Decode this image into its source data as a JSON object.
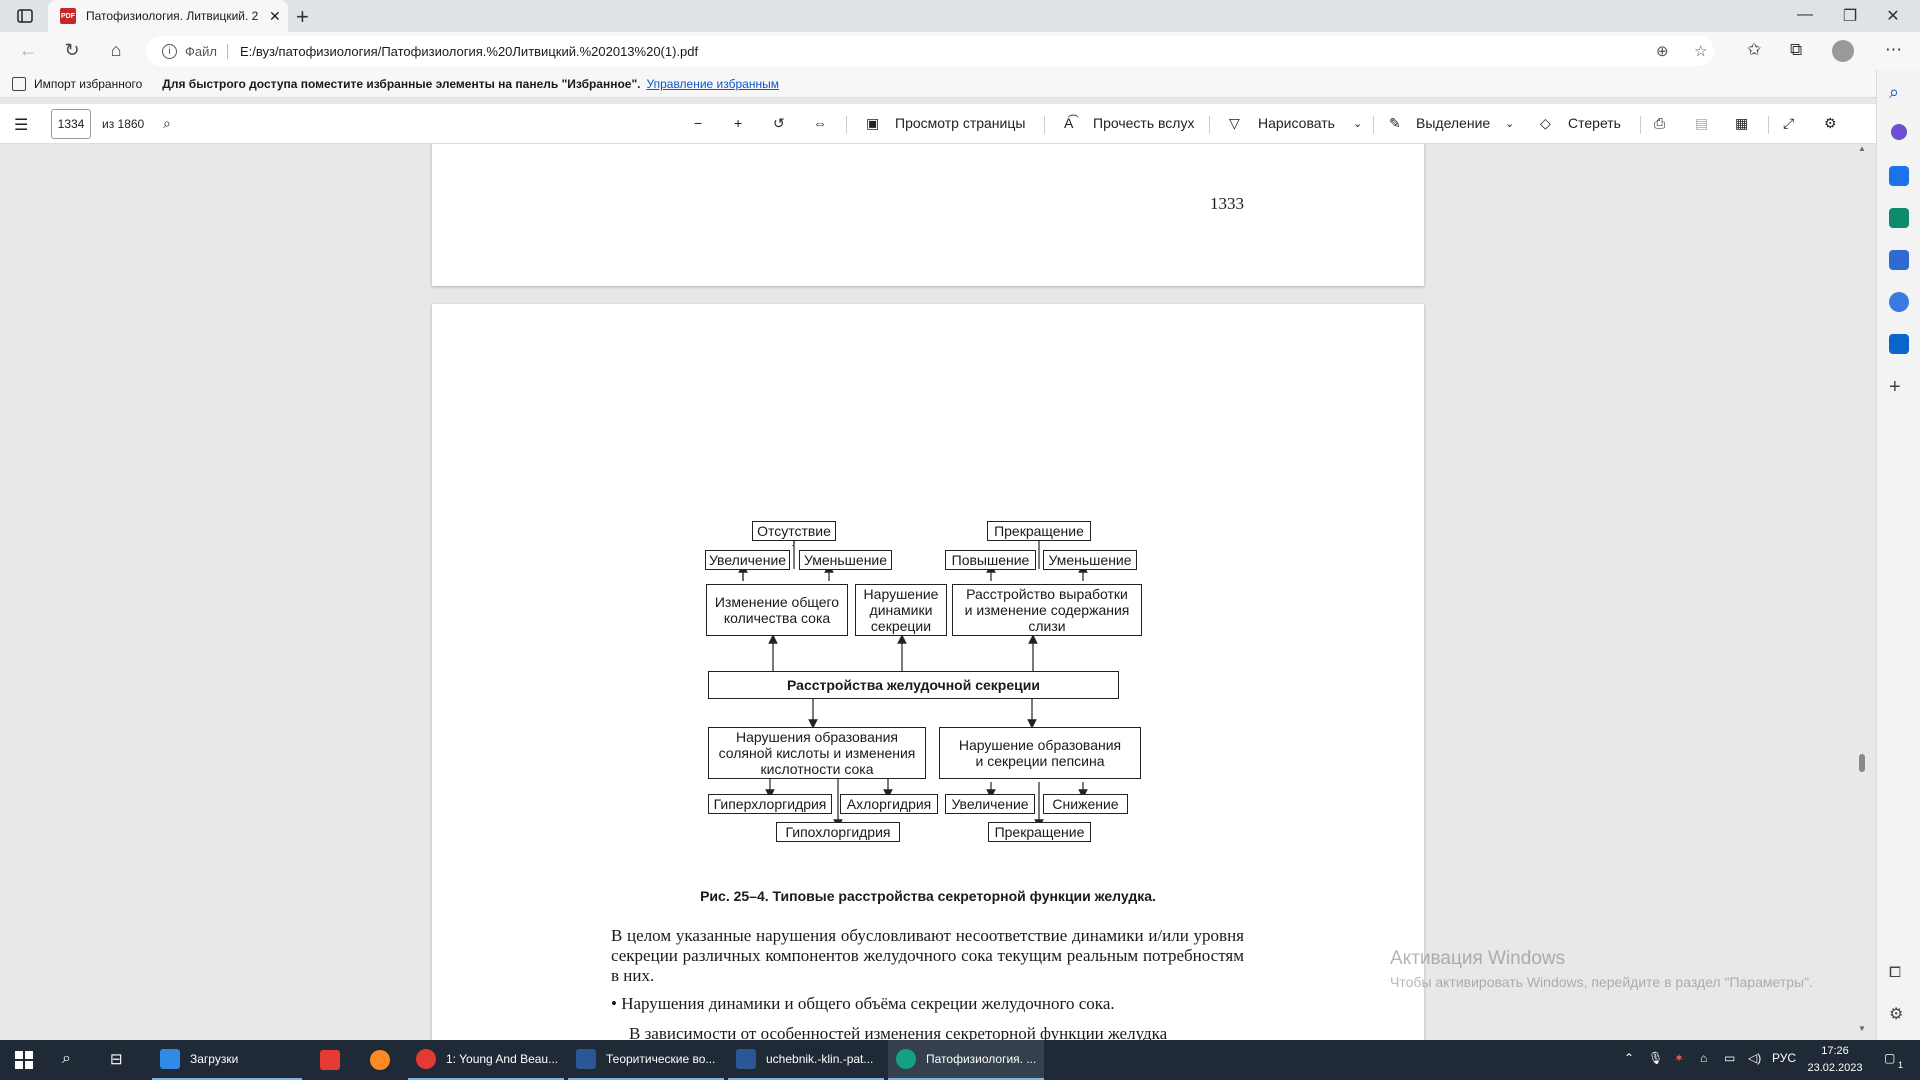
{
  "browser": {
    "tab_title": "Патофизиология. Литвицкий. 2",
    "address": {
      "scheme": "Файл",
      "url": "E:/вуз/патофизиология/Патофизиология.%20Литвицкий.%202013%20(1).pdf"
    },
    "favorites": {
      "import_label": "Импорт избранного",
      "hint": "Для быстрого доступа поместите избранные элементы на панель \"Избранное\".",
      "manage_link": "Управление избранным"
    }
  },
  "pdf_toolbar": {
    "page_current": "1334",
    "page_total": "из 1860",
    "page_view": "Просмотр страницы",
    "read_aloud": "Прочесть вслух",
    "draw": "Нарисовать",
    "highlight": "Выделение",
    "erase": "Стереть"
  },
  "document": {
    "prev_page_number": "1333",
    "diagram": {
      "top_left": "Отсутствие",
      "top_right": "Прекращение",
      "increase_1": "Увеличение",
      "decrease_1": "Уменьшение",
      "raise_2": "Повышение",
      "decrease_2": "Уменьшение",
      "box_total_1": "Изменение общего",
      "box_total_2": "количества сока",
      "box_dyn_1": "Нарушение",
      "box_dyn_2": "динамики",
      "box_dyn_3": "секреции",
      "box_mucus_1": "Расстройство выработки",
      "box_mucus_2": "и изменение содержания",
      "box_mucus_3": "слизи",
      "center": "Расстройства желудочной секреции",
      "box_hcl_1": "Нарушения образования",
      "box_hcl_2": "соляной кислоты и изменения",
      "box_hcl_3": "кислотности сока",
      "box_pepsin_1": "Нарушение образования",
      "box_pepsin_2": "и секреции пепсина",
      "hyper": "Гиперхлоргидрия",
      "achlor": "Ахлоргидрия",
      "increase_3": "Увеличение",
      "reduce_3": "Снижение",
      "hypo": "Гипохлоргидрия",
      "stop_bottom": "Прекращение"
    },
    "caption": "Рис. 25–4. Типовые расстройства секреторной функции желудка.",
    "paragraph_1": "В целом указанные нарушения обусловливают несоответствие динамики и/или уровня секреции различных компонентов желудочного сока текущим реальным потребностям в них.",
    "paragraph_2": "• Нарушения динамики и общего объёма секреции желудочного сока.",
    "paragraph_3": "В зависимости от особенностей изменения секреторной функции желудка"
  },
  "watermark": {
    "title": "Активация Windows",
    "text": "Чтобы активировать Windows, перейдите в раздел \"Параметры\"."
  },
  "taskbar": {
    "apps": [
      "Загрузки",
      "1: Young And Beau...",
      "Теоритические во...",
      "uchebnik.-klin.-pat...",
      "Патофизиология. ..."
    ],
    "lang": "РУС",
    "time": "17:26",
    "date": "23.02.2023",
    "notif_count": "1"
  },
  "colors": {
    "accent": "#0b57d0",
    "taskbar": "#1f2a36",
    "pdf_red": "#c62828"
  }
}
